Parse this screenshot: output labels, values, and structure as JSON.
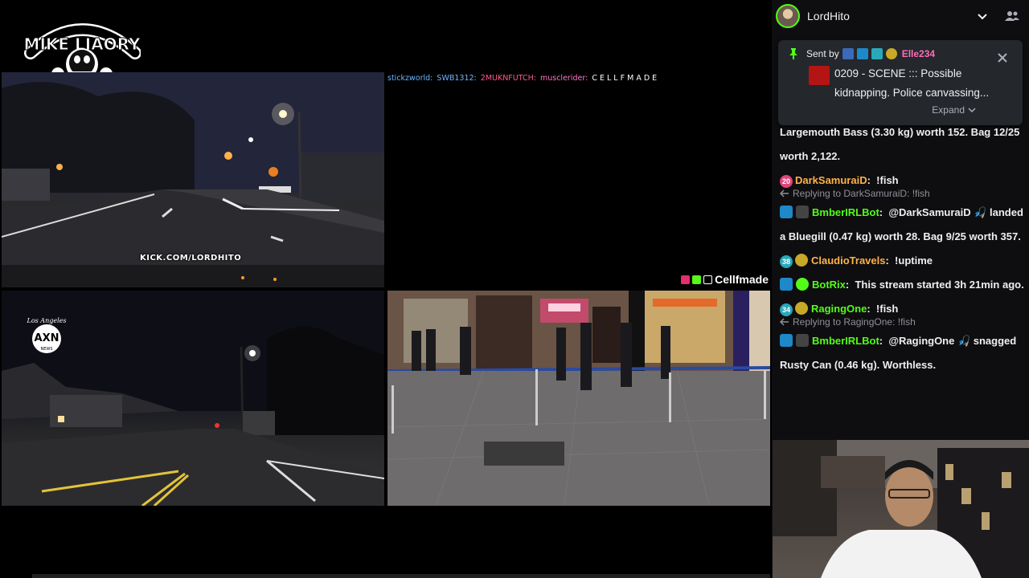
{
  "stream": {
    "logo_text": "MIKE LIAORY",
    "watermark": "KICK.COM/LORDHITO",
    "axn_badge": {
      "top": "Los Angeles",
      "main": "AXN",
      "sub": "NEWS"
    },
    "ticker": [
      {
        "name": "stickzworld:",
        "color": "#6fb6ff"
      },
      {
        "name": "SWB1312:",
        "color": "#6fb6ff"
      },
      {
        "name": "2MUKNFUTCH:",
        "color": "#ff5a8a"
      },
      {
        "name": "musclerider:",
        "color": "#ff79c6"
      },
      {
        "name": "C E  L  L  F M A D E",
        "color": "#ffffff"
      }
    ],
    "social_handle": "Cellfmade"
  },
  "chat": {
    "channel_name": "LordHito",
    "pinned": {
      "sent_by_label": "Sent by",
      "sender": "Elle234",
      "message": "0209 - SCENE ::: Possible kidnapping. Police canvassing...",
      "expand_label": "Expand"
    },
    "messages": [
      {
        "type": "continuation",
        "text": "Largemouth Bass (3.30 kg) worth 152. Bag 12/25 worth 2,122."
      },
      {
        "type": "message",
        "badge_num": "20",
        "badge_color": "#e0457b",
        "user": "DarkSamuraiD",
        "user_color": "#ffb347",
        "text": "!fish"
      },
      {
        "type": "reply",
        "text": "Replying to DarkSamuraiD: !fish"
      },
      {
        "type": "message",
        "bot": true,
        "user": "BmberIRLBot",
        "user_color": "#53fc18",
        "text": "@DarkSamuraiD 🎣 landed a Bluegill (0.47 kg) worth 28. Bag 9/25 worth 357."
      },
      {
        "type": "message",
        "badge_num": "38",
        "badge_color": "#2aa7b8",
        "user": "ClaudioTravels",
        "user_color": "#ffb347",
        "text": "!uptime"
      },
      {
        "type": "message",
        "bot": true,
        "verified": true,
        "user": "BotRix",
        "user_color": "#53fc18",
        "text": "This stream started 3h 21min ago."
      },
      {
        "type": "message",
        "badge_num": "34",
        "badge_color": "#2aa7b8",
        "user": "RagingOne",
        "user_color": "#53fc18",
        "text": "!fish"
      },
      {
        "type": "reply",
        "text": "Replying to RagingOne: !fish"
      },
      {
        "type": "message",
        "bot": true,
        "user": "BmberIRLBot",
        "user_color": "#53fc18",
        "text": "@RagingOne 🎣 snagged Rusty Can (0.46 kg). Worthless."
      }
    ]
  }
}
